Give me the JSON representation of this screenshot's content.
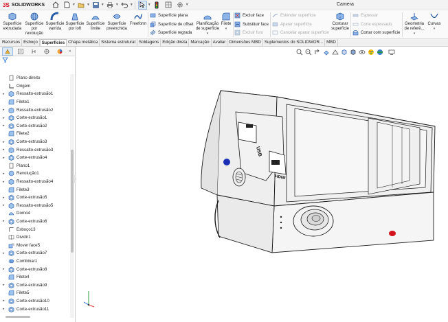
{
  "app": {
    "brand": "SOLIDWORKS",
    "document_title": "Camera"
  },
  "colors": {
    "accent_blue": "#1f6fd0",
    "brand_red": "#d0111b",
    "panel_highlight": "#dbe8f6",
    "dot_blue": "#1b2fb4",
    "dot_red": "#d4141c"
  },
  "quick_access": [
    {
      "name": "home-icon"
    },
    {
      "name": "new-document-icon"
    },
    {
      "name": "open-folder-icon"
    },
    {
      "name": "save-icon"
    },
    {
      "name": "print-icon"
    },
    {
      "name": "undo-icon"
    },
    {
      "name": "select-arrow-icon"
    },
    {
      "name": "traffic-light-icon"
    },
    {
      "name": "options-gear-icon"
    }
  ],
  "ribbon": {
    "big_buttons": [
      {
        "label": "Superfície extrudada"
      },
      {
        "label": "Superfície por revolução"
      },
      {
        "label": "Superfície varrida"
      },
      {
        "label": "Superfície por loft"
      },
      {
        "label": "Superfície limite"
      },
      {
        "label": "Superfície preenchida"
      },
      {
        "label": "Freeform"
      }
    ],
    "group1_small": [
      {
        "label": "Superfície plana"
      },
      {
        "label": "Superfície de offset"
      },
      {
        "label": "Superfície regrada"
      }
    ],
    "planificacao": "Planificação de superfície",
    "filete": "Filete",
    "group2_small": [
      {
        "label": "Excluir face"
      },
      {
        "label": "Substituir face"
      },
      {
        "label": "Excluir furo"
      }
    ],
    "group3_small": [
      {
        "label": "Estender superfície"
      },
      {
        "label": "Aparar superfície"
      },
      {
        "label": "Cancelar aparar superfície"
      }
    ],
    "costurar": "Costurar superfície",
    "group4_small": [
      {
        "label": "Espessar"
      },
      {
        "label": "Corte espessado"
      },
      {
        "label": "Cortar com superfície"
      }
    ],
    "geometria": "Geometria de referê...",
    "curvas": "Curvas"
  },
  "tabs": [
    {
      "label": "Recursos",
      "active": false
    },
    {
      "label": "Esboço",
      "active": false
    },
    {
      "label": "Superfícies",
      "active": true
    },
    {
      "label": "Chapa metálica",
      "active": false
    },
    {
      "label": "Sistema estrutural",
      "active": false
    },
    {
      "label": "Soldagens",
      "active": false
    },
    {
      "label": "Edição direta",
      "active": false
    },
    {
      "label": "Marcação",
      "active": false
    },
    {
      "label": "Avaliar",
      "active": false
    },
    {
      "label": "Dimensões MBD",
      "active": false
    },
    {
      "label": "Suplementos do SOLIDWOR...",
      "active": false
    },
    {
      "label": "MBD",
      "active": false
    }
  ],
  "tree": [
    {
      "label": "Plano direito",
      "icon": "plane",
      "expandable": false
    },
    {
      "label": "Origem",
      "icon": "origin",
      "expandable": false
    },
    {
      "label": "Ressalto-extrusão1",
      "icon": "boss",
      "expandable": true
    },
    {
      "label": "Filete1",
      "icon": "fillet",
      "expandable": false
    },
    {
      "label": "Ressalto-extrusão2",
      "icon": "boss",
      "expandable": true
    },
    {
      "label": "Corte-extrusão1",
      "icon": "cut",
      "expandable": true
    },
    {
      "label": "Corte-extrusão2",
      "icon": "cut",
      "expandable": true
    },
    {
      "label": "Filete2",
      "icon": "fillet",
      "expandable": false
    },
    {
      "label": "Corte-extrusão3",
      "icon": "cut",
      "expandable": true
    },
    {
      "label": "Ressalto-extrusão3",
      "icon": "boss",
      "expandable": true
    },
    {
      "label": "Corte-extrusão4",
      "icon": "cut",
      "expandable": true
    },
    {
      "label": "Plano1",
      "icon": "plane",
      "expandable": false
    },
    {
      "label": "Revolução1",
      "icon": "revolve",
      "expandable": true
    },
    {
      "label": "Ressalto-extrusão4",
      "icon": "boss",
      "expandable": true
    },
    {
      "label": "Filete3",
      "icon": "fillet",
      "expandable": false
    },
    {
      "label": "Corte-extrusão5",
      "icon": "cut",
      "expandable": true
    },
    {
      "label": "Ressalto-extrusão5",
      "icon": "boss",
      "expandable": true
    },
    {
      "label": "Domo4",
      "icon": "dome",
      "expandable": false
    },
    {
      "label": "Corte-extrusão6",
      "icon": "cut",
      "expandable": true
    },
    {
      "label": "Esboço13",
      "icon": "sketch",
      "expandable": false
    },
    {
      "label": "Dividir1",
      "icon": "split",
      "expandable": false
    },
    {
      "label": "Mover face5",
      "icon": "moveface",
      "expandable": false
    },
    {
      "label": "Corte-extrusão7",
      "icon": "cut",
      "expandable": true
    },
    {
      "label": "Combinar1",
      "icon": "combine",
      "expandable": false
    },
    {
      "label": "Corte-extrusão8",
      "icon": "cut",
      "expandable": true
    },
    {
      "label": "Filete4",
      "icon": "fillet",
      "expandable": false
    },
    {
      "label": "Corte-extrusão9",
      "icon": "cut",
      "expandable": true
    },
    {
      "label": "Filete5",
      "icon": "fillet",
      "expandable": false
    },
    {
      "label": "Corte-extrusão10",
      "icon": "cut",
      "expandable": true
    },
    {
      "label": "Corte-extrusão11",
      "icon": "cut",
      "expandable": true
    }
  ],
  "model": {
    "port_labels": [
      "USB",
      "HDMI"
    ]
  }
}
